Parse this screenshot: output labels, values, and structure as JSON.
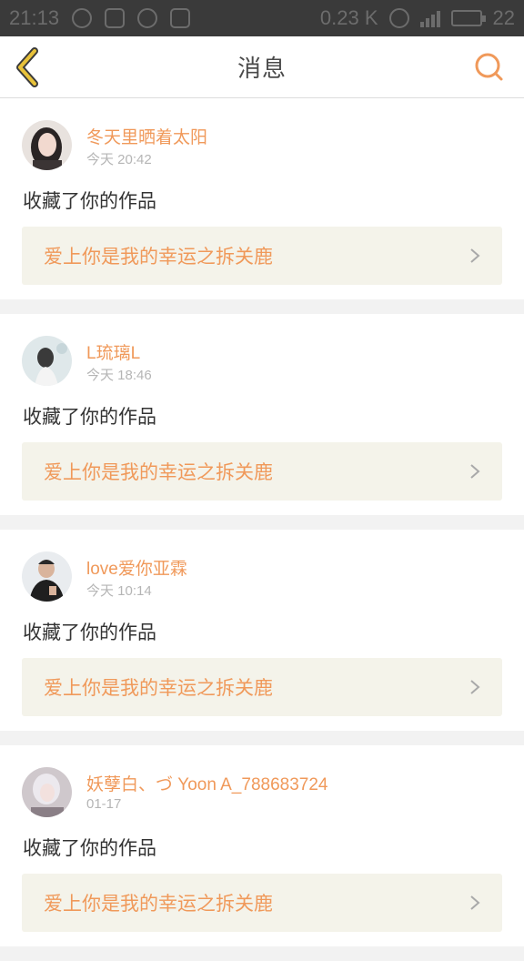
{
  "status_bar": {
    "time": "21:13",
    "speed": "0.23 K",
    "battery": "22"
  },
  "header": {
    "title": "消息",
    "back_icon": "back-chevron-icon",
    "search_icon": "search-icon"
  },
  "colors": {
    "accent": "#f0995a",
    "back_icon": "#e8c23a",
    "link_bg": "#f4f3ea"
  },
  "messages": [
    {
      "user": "冬天里晒着太阳",
      "time": "今天 20:42",
      "action": "收藏了你的作品",
      "work": "爱上你是我的幸运之拆关鹿"
    },
    {
      "user": "L琉璃L",
      "time": "今天 18:46",
      "action": "收藏了你的作品",
      "work": "爱上你是我的幸运之拆关鹿"
    },
    {
      "user": "love爱你亚霖",
      "time": "今天 10:14",
      "action": "收藏了你的作品",
      "work": "爱上你是我的幸运之拆关鹿"
    },
    {
      "user": "妖孽白、づ Yoon A_788683724",
      "time": "01-17",
      "action": "收藏了你的作品",
      "work": "爱上你是我的幸运之拆关鹿"
    }
  ]
}
